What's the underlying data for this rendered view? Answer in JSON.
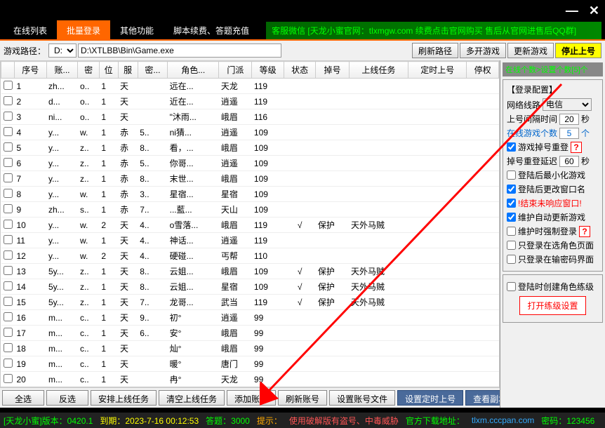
{
  "titlebar": {
    "min": "—",
    "close": "✕"
  },
  "tabs": {
    "t1": "在线列表",
    "t2": "批量登录",
    "t3": "其他功能",
    "t4": "脚本续费、答题充值"
  },
  "marquee": "客服微信 [天龙小蜜官网：tlxmgw.com 续费点击官网购买 售后从官网进售后QQ群]",
  "toolbar": {
    "pathLabel": "游戏路径：",
    "drive": "D:",
    "path": "D:\\XTLBB\\Bin\\Game.exe",
    "refresh": "刷新路径",
    "multi": "多开游戏",
    "update": "更新游戏",
    "stop": "停止上号"
  },
  "rightHead": "在线个数>设置个数[5]个",
  "cfg": {
    "title": "【登录配置】",
    "netLabel": "网络线路",
    "netVal": "电信",
    "intervalLabel": "上号间隔时间",
    "intervalVal": "20",
    "sec": "秒",
    "onlineLabel": "在线游戏个数",
    "onlineVal": "5",
    "ge": "个",
    "dropRelogin": "游戏掉号重登",
    "dropDelayLabel": "掉号重登延迟",
    "dropDelayVal": "60",
    "minAfter": "登陆后最小化游戏",
    "renameAfter": "登陆后更改窗口名",
    "killNoResp": "!结束未响应窗口!",
    "maintAuto": "维护自动更新游戏",
    "maintForce": "维护时强制登录",
    "onlySelect": "只登录在选角色页面",
    "onlyPwd": "只登录在输密码界面",
    "createRole": "登陆时创建角色练级",
    "openLvl": "打开练级设置"
  },
  "cols": {
    "seq": "序号",
    "acc": "账...",
    "pwd": "密",
    "pos": "位",
    "srv": "服",
    "sec": "密...",
    "role": "角色...",
    "sect": "门派",
    "lvl": "等级",
    "state": "状态",
    "drop": "掉号",
    "task": "上线任务",
    "timer": "定时上号",
    "stop": "停权"
  },
  "rows": [
    {
      "n": "1",
      "a": "zh...",
      "p": "o..",
      "po": "1",
      "s": "天",
      "c": "",
      "r": "远在...",
      "m": "天龙",
      "l": "119"
    },
    {
      "n": "2",
      "a": "d...",
      "p": "o..",
      "po": "1",
      "s": "天",
      "c": "",
      "r": "近在...",
      "m": "逍遥",
      "l": "119"
    },
    {
      "n": "3",
      "a": "ni...",
      "p": "o..",
      "po": "1",
      "s": "天",
      "c": "",
      "r": "\"沐雨...",
      "m": "峨眉",
      "l": "116"
    },
    {
      "n": "4",
      "a": "y...",
      "p": "w.",
      "po": "1",
      "s": "赤",
      "c": "5..",
      "r": "ni猜...",
      "m": "逍遥",
      "l": "109"
    },
    {
      "n": "5",
      "a": "y...",
      "p": "z..",
      "po": "1",
      "s": "赤",
      "c": "8..",
      "r": "看，...",
      "m": "峨眉",
      "l": "109"
    },
    {
      "n": "6",
      "a": "y...",
      "p": "z..",
      "po": "1",
      "s": "赤",
      "c": "5..",
      "r": "你哥...",
      "m": "逍遥",
      "l": "109"
    },
    {
      "n": "7",
      "a": "y...",
      "p": "z..",
      "po": "1",
      "s": "赤",
      "c": "8..",
      "r": "末世...",
      "m": "峨眉",
      "l": "109"
    },
    {
      "n": "8",
      "a": "y...",
      "p": "w.",
      "po": "1",
      "s": "赤",
      "c": "3..",
      "r": "星宿...",
      "m": "星宿",
      "l": "109"
    },
    {
      "n": "9",
      "a": "zh...",
      "p": "s..",
      "po": "1",
      "s": "赤",
      "c": "7..",
      "r": "...藍...",
      "m": "天山",
      "l": "109"
    },
    {
      "n": "10",
      "a": "y...",
      "p": "w.",
      "po": "2",
      "s": "天",
      "c": "4..",
      "r": "o雪落...",
      "m": "峨眉",
      "l": "119",
      "st": "√",
      "dr": "保护",
      "ta": "天外马贼"
    },
    {
      "n": "11",
      "a": "y...",
      "p": "w.",
      "po": "1",
      "s": "天",
      "c": "4..",
      "r": "神话...",
      "m": "逍遥",
      "l": "119"
    },
    {
      "n": "12",
      "a": "y...",
      "p": "w.",
      "po": "2",
      "s": "天",
      "c": "4..",
      "r": "硬碰...",
      "m": "丐帮",
      "l": "110"
    },
    {
      "n": "13",
      "a": "5y...",
      "p": "z..",
      "po": "1",
      "s": "天",
      "c": "8..",
      "r": "云姐...",
      "m": "峨眉",
      "l": "109",
      "st": "√",
      "dr": "保护",
      "ta": "天外马贼"
    },
    {
      "n": "14",
      "a": "5y...",
      "p": "z..",
      "po": "1",
      "s": "天",
      "c": "8..",
      "r": "云姐...",
      "m": "星宿",
      "l": "109",
      "st": "√",
      "dr": "保护",
      "ta": "天外马贼"
    },
    {
      "n": "15",
      "a": "5y...",
      "p": "z..",
      "po": "1",
      "s": "天",
      "c": "7..",
      "r": "龙哥...",
      "m": "武当",
      "l": "119",
      "st": "√",
      "dr": "保护",
      "ta": "天外马贼"
    },
    {
      "n": "16",
      "a": "m...",
      "p": "c..",
      "po": "1",
      "s": "天",
      "c": "9..",
      "r": "初°",
      "m": "逍遥",
      "l": "99"
    },
    {
      "n": "17",
      "a": "m...",
      "p": "c..",
      "po": "1",
      "s": "天",
      "c": "6..",
      "r": "安°",
      "m": "峨眉",
      "l": "99"
    },
    {
      "n": "18",
      "a": "m...",
      "p": "c..",
      "po": "1",
      "s": "天",
      "c": "",
      "r": "灿°",
      "m": "峨眉",
      "l": "99"
    },
    {
      "n": "19",
      "a": "m...",
      "p": "c..",
      "po": "1",
      "s": "天",
      "c": "",
      "r": "暖°",
      "m": "唐门",
      "l": "99"
    },
    {
      "n": "20",
      "a": "m...",
      "p": "c..",
      "po": "1",
      "s": "天",
      "c": "",
      "r": "冉°",
      "m": "天龙",
      "l": "99"
    }
  ],
  "actions": {
    "all": "全选",
    "inv": "反选",
    "arrange": "安排上线任务",
    "clear": "清空上线任务",
    "add": "添加账号",
    "refresh": "刷新账号",
    "setfile": "设置账号文件",
    "timer": "设置定时上号",
    "viewcopy": "查看副本次数"
  },
  "status": {
    "ver": "[天龙小蜜]版本：0420.1",
    "exp": "到期：2023-7-16 00:12:53",
    "ans": "答题：3000",
    "tip": "提示：",
    "tipTxt": "使用破解版有盗号、中毒威胁",
    "dl": "官方下载地址：",
    "dlUrl": "tlxm.cccpan.com",
    "pwd": "密码：123456"
  }
}
